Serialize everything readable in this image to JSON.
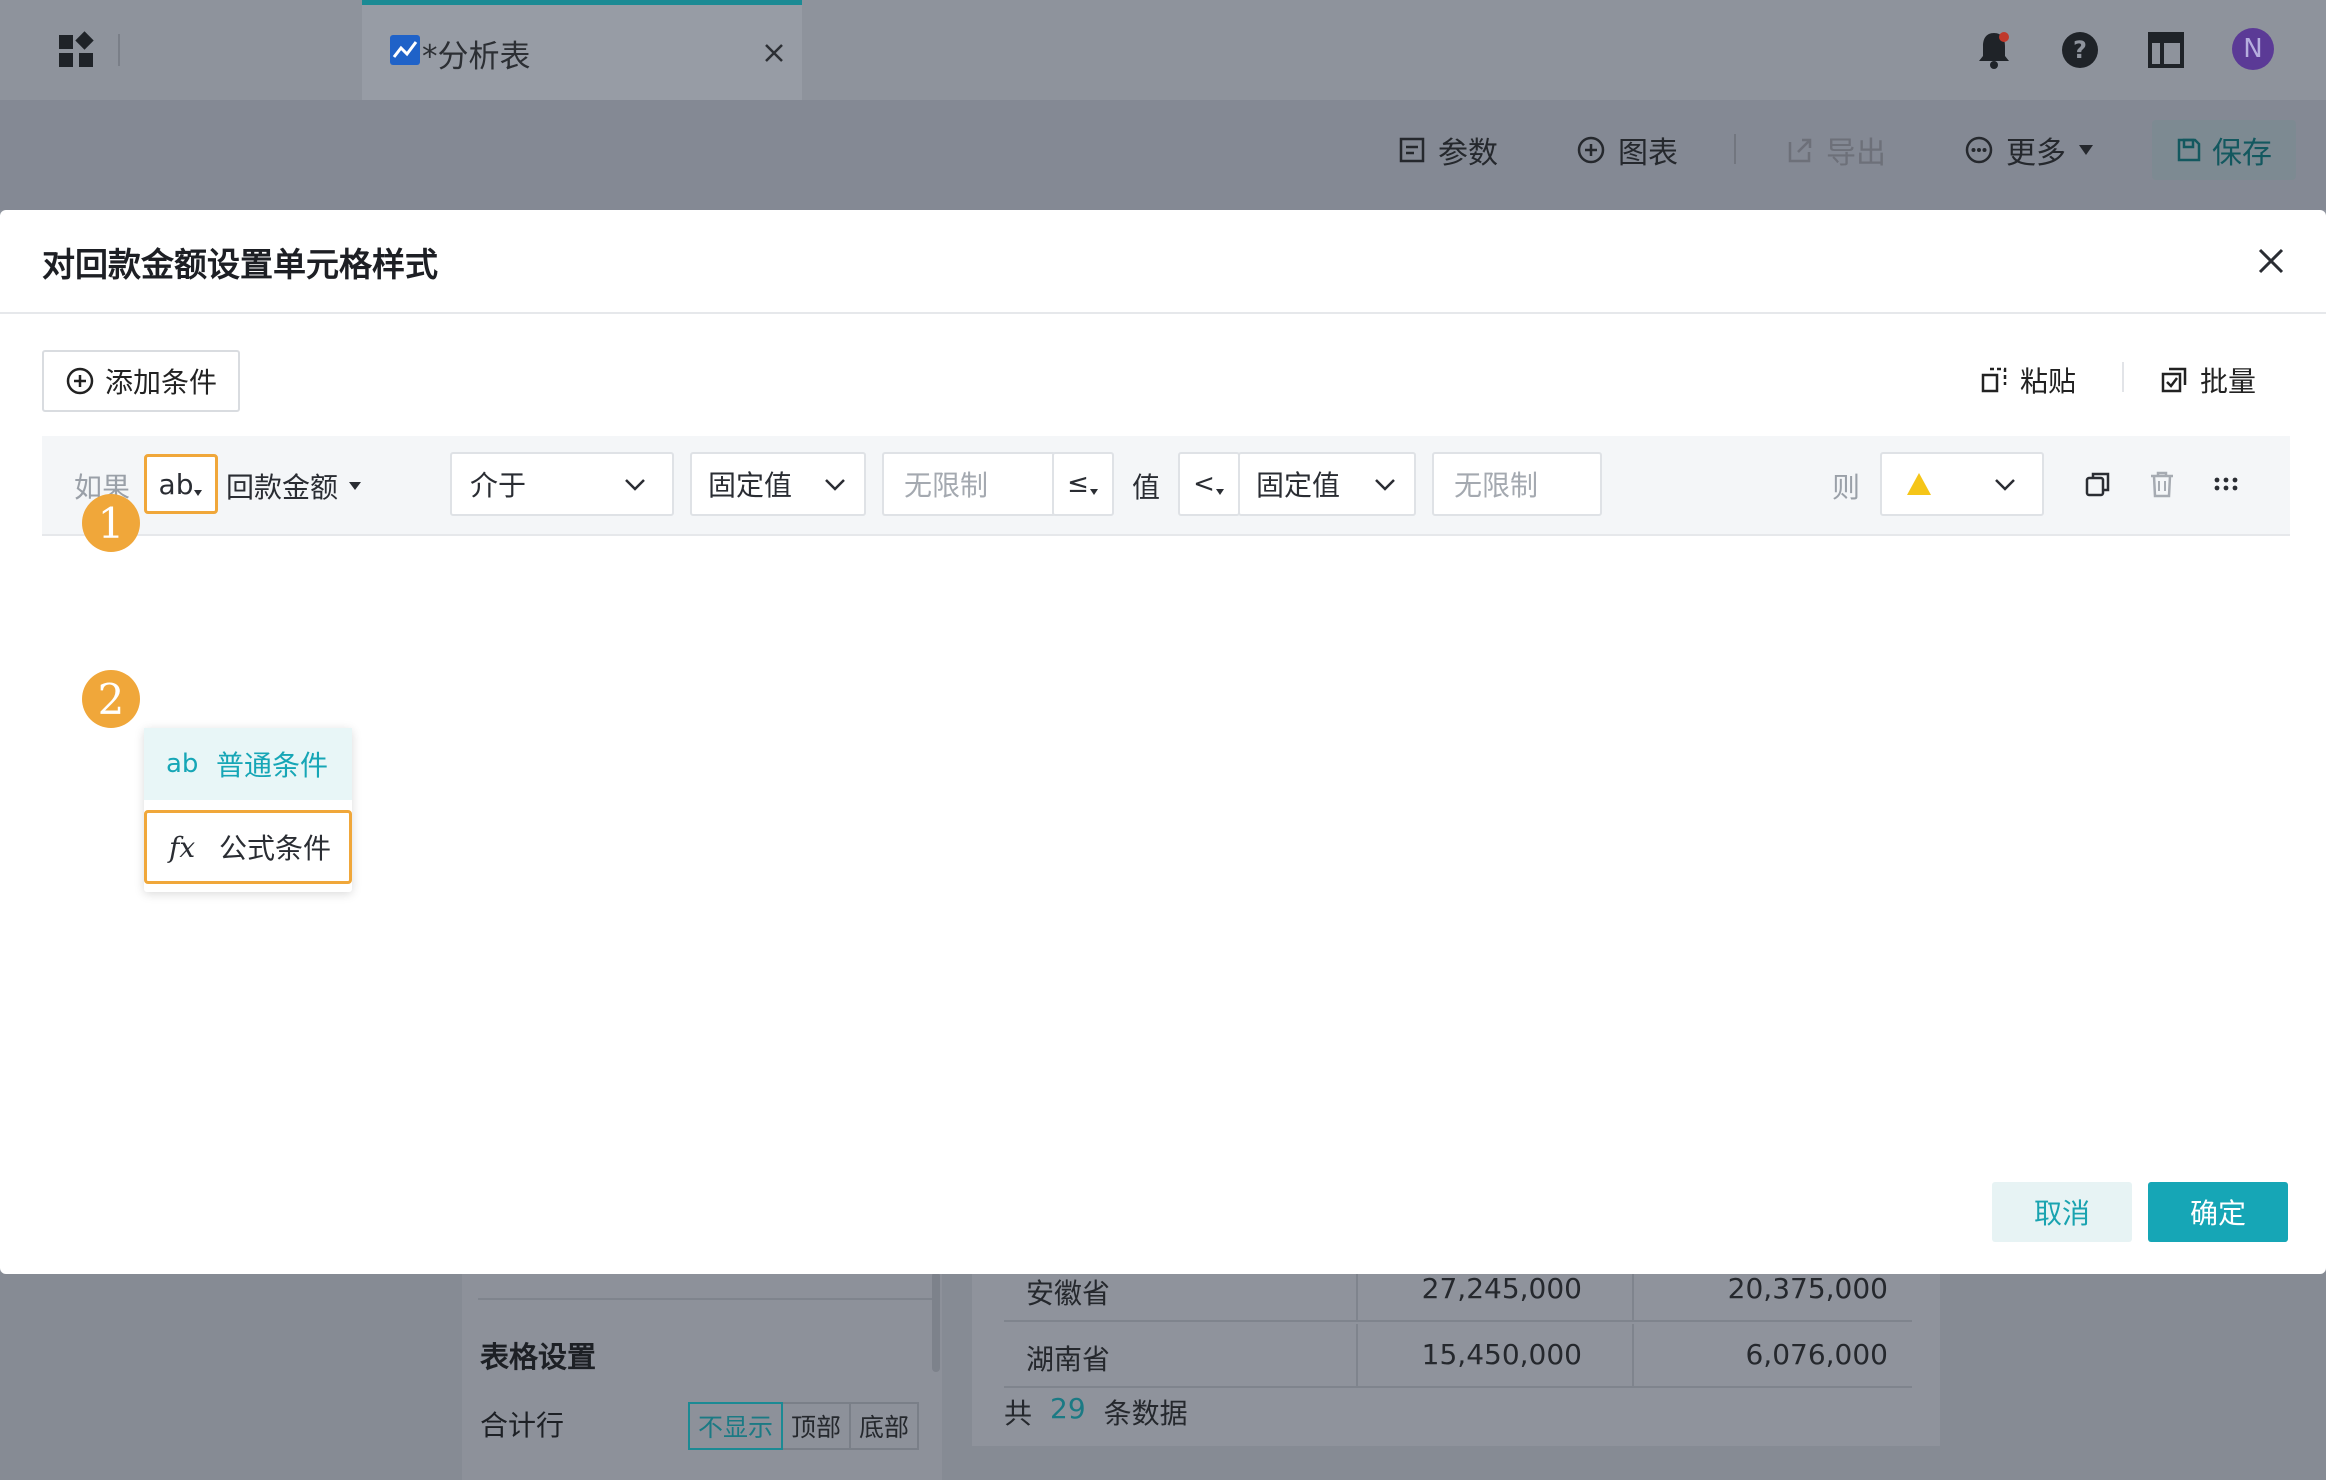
{
  "app": {
    "tab_title": "*分析表",
    "toolbar": {
      "params_label": "参数",
      "chart_label": "图表",
      "export_label": "导出",
      "more_label": "更多",
      "save_label": "保存"
    },
    "user_initial": "N"
  },
  "background": {
    "table_settings_title": "表格设置",
    "total_row_label": "合计行",
    "total_row_options": [
      "不显示",
      "顶部",
      "底部"
    ],
    "rows": [
      {
        "province": "安徽省",
        "v1": "27,245,000",
        "v2": "20,375,000"
      },
      {
        "province": "湖南省",
        "v1": "15,450,000",
        "v2": "6,076,000"
      }
    ],
    "count_prefix": "共",
    "count_value": "29",
    "count_suffix": "条数据"
  },
  "dialog": {
    "title": "对回款金额设置单元格样式",
    "add_condition_label": "添加条件",
    "paste_label": "粘贴",
    "batch_label": "批量",
    "condition": {
      "if_label": "如果",
      "type_button": "ab",
      "field_name": "回款金额",
      "operator": "介于",
      "left_mode": "固定值",
      "left_placeholder": "无限制",
      "left_compare": "≤",
      "value_label": "值",
      "right_compare": "<",
      "right_mode": "固定值",
      "right_placeholder": "无限制",
      "then_label": "则",
      "then_style_color": "#f5c518"
    },
    "type_menu": [
      {
        "icon": "ab",
        "label": "普通条件"
      },
      {
        "icon": "fx",
        "label": "公式条件"
      }
    ],
    "step_badges": [
      "1",
      "2"
    ],
    "cancel_label": "取消",
    "ok_label": "确定"
  },
  "colors": {
    "accent": "#16a6b6",
    "highlight": "#f0a73a"
  }
}
